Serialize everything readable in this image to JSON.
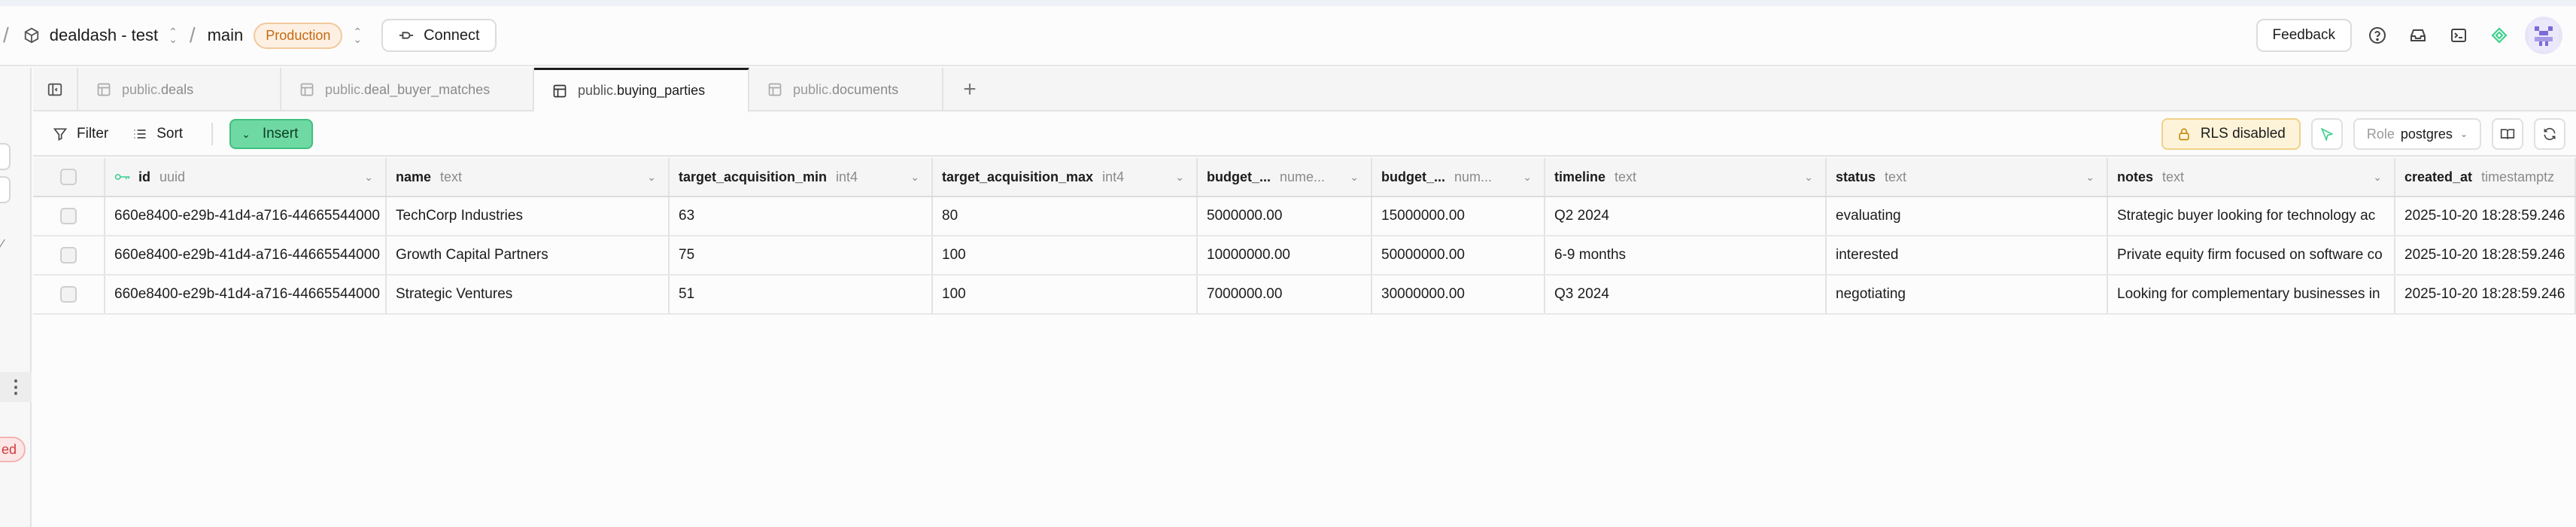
{
  "topbar": {
    "project_name": "dealdash - test",
    "branch": "main",
    "env_badge": "Production",
    "connect_label": "Connect",
    "feedback_label": "Feedback"
  },
  "leftrail": {
    "badge_text": "ed"
  },
  "tabs": [
    {
      "prefix": "public.",
      "name": "deals",
      "active": false
    },
    {
      "prefix": "public.",
      "name": "deal_buyer_matches",
      "active": false
    },
    {
      "prefix": "public.",
      "name": "buying_parties",
      "active": true
    },
    {
      "prefix": "public.",
      "name": "documents",
      "active": false
    }
  ],
  "toolbar": {
    "filter_label": "Filter",
    "sort_label": "Sort",
    "insert_label": "Insert",
    "rls_label": "RLS disabled",
    "role_label": "Role",
    "role_value": "postgres"
  },
  "colors": {
    "accent": "#3ecf8e",
    "insert_bg": "#6fd9a4",
    "rls_bg": "#fdf3d9",
    "prod_badge": "#c6690f"
  },
  "columns": [
    {
      "name": "id",
      "type": "uuid"
    },
    {
      "name": "name",
      "type": "text"
    },
    {
      "name": "target_acquisition_min",
      "type": "int4"
    },
    {
      "name": "target_acquisition_max",
      "type": "int4"
    },
    {
      "name": "budget_...",
      "type": "nume..."
    },
    {
      "name": "budget_...",
      "type": "num..."
    },
    {
      "name": "timeline",
      "type": "text"
    },
    {
      "name": "status",
      "type": "text"
    },
    {
      "name": "notes",
      "type": "text"
    },
    {
      "name": "created_at",
      "type": "timestamptz"
    }
  ],
  "rows": [
    [
      "660e8400-e29b-41d4-a716-44665544000",
      "TechCorp Industries",
      "63",
      "80",
      "5000000.00",
      "15000000.00",
      "Q2 2024",
      "evaluating",
      "Strategic buyer looking for technology ac",
      "2025-10-20 18:28:59.246"
    ],
    [
      "660e8400-e29b-41d4-a716-44665544000",
      "Growth Capital Partners",
      "75",
      "100",
      "10000000.00",
      "50000000.00",
      "6-9 months",
      "interested",
      "Private equity firm focused on software co",
      "2025-10-20 18:28:59.246"
    ],
    [
      "660e8400-e29b-41d4-a716-44665544000",
      "Strategic Ventures",
      "51",
      "100",
      "7000000.00",
      "30000000.00",
      "Q3 2024",
      "negotiating",
      "Looking for complementary businesses in",
      "2025-10-20 18:28:59.246"
    ]
  ]
}
